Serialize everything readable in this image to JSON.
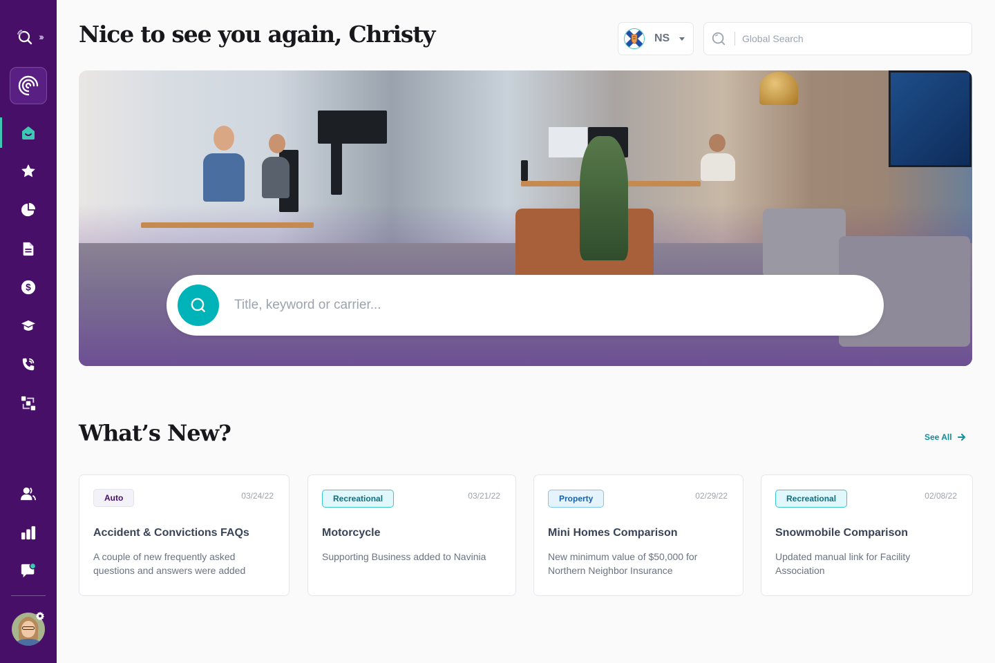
{
  "header": {
    "greeting": "Nice to see you again, Christy",
    "region": {
      "code": "NS",
      "flag": "nova-scotia-flag"
    },
    "global_search": {
      "placeholder": "Global Search",
      "value": ""
    }
  },
  "sidebar": {
    "items": [
      {
        "name": "home",
        "icon": "home-icon",
        "active": true
      },
      {
        "name": "favorites",
        "icon": "star-icon",
        "active": false
      },
      {
        "name": "analytics",
        "icon": "pie-chart-icon",
        "active": false
      },
      {
        "name": "documents",
        "icon": "document-icon",
        "active": false
      },
      {
        "name": "billing",
        "icon": "dollar-icon",
        "active": false
      },
      {
        "name": "training",
        "icon": "graduation-cap-icon",
        "active": false
      },
      {
        "name": "calls",
        "icon": "phone-icon",
        "active": false
      },
      {
        "name": "workflow",
        "icon": "workflow-icon",
        "active": false
      },
      {
        "name": "contacts",
        "icon": "users-icon",
        "active": false
      },
      {
        "name": "reports",
        "icon": "bar-chart-icon",
        "active": false
      },
      {
        "name": "messages",
        "icon": "chat-notification-icon",
        "active": false
      }
    ],
    "colors": {
      "background": "#470f68",
      "active": "#3ec8b4"
    }
  },
  "hero": {
    "search_placeholder": "Title, keyword or carrier...",
    "search_value": ""
  },
  "whats_new": {
    "title": "What’s New?",
    "see_all": "See All",
    "cards": [
      {
        "tag": "Auto",
        "tag_type": "auto",
        "date": "03/24/22",
        "title": "Accident & Convictions FAQs",
        "description": "A couple of new frequently asked questions and answers were added"
      },
      {
        "tag": "Recreational",
        "tag_type": "recreational",
        "date": "03/21/22",
        "title": "Motorcycle",
        "description": "Supporting Business added to Navinia"
      },
      {
        "tag": "Property",
        "tag_type": "property",
        "date": "02/29/22",
        "title": "Mini Homes Comparison",
        "description": "New minimum value of $50,000 for Northern Neighbor Insurance"
      },
      {
        "tag": "Recreational",
        "tag_type": "recreational",
        "date": "02/08/22",
        "title": "Snowmobile Comparison",
        "description": "Updated manual link for Facility Association"
      }
    ]
  },
  "colors": {
    "accent": "#00b3b8",
    "link": "#0f8f9a"
  }
}
